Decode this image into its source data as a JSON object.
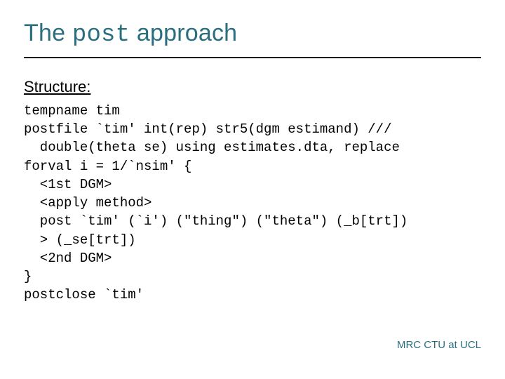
{
  "title": {
    "pre": "The ",
    "code": "post",
    "post": " approach"
  },
  "section_label": "Structure:",
  "code_lines": [
    "tempname tim",
    "postfile `tim' int(rep) str5(dgm estimand) ///",
    "  double(theta se) using estimates.dta, replace",
    "forval i = 1/`nsim' {",
    "  <1st DGM>",
    "  <apply method>",
    "  post `tim' (`i') (\"thing\") (\"theta\") (_b[trt])",
    "  > (_se[trt])",
    "  <2nd DGM>",
    "}",
    "postclose `tim'"
  ],
  "footer": "MRC CTU at UCL"
}
